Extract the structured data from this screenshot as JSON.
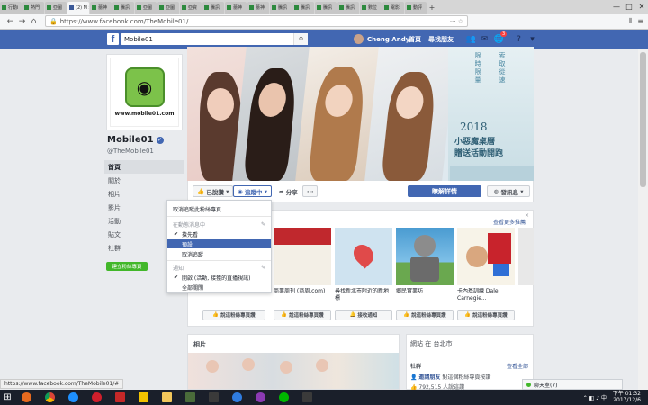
{
  "browser": {
    "tabs": [
      {
        "label": "行動i"
      },
      {
        "label": "熱門"
      },
      {
        "label": "亞圖"
      },
      {
        "label": "(2) M",
        "active": true
      },
      {
        "label": "蕾神"
      },
      {
        "label": "騰訊"
      },
      {
        "label": "亞圖"
      },
      {
        "label": "亞圖"
      },
      {
        "label": "亞資"
      },
      {
        "label": "騰訊"
      },
      {
        "label": "蕾神"
      },
      {
        "label": "蕾神"
      },
      {
        "label": "騰訊"
      },
      {
        "label": "騰訊"
      },
      {
        "label": "騰訊"
      },
      {
        "label": "騰訊"
      },
      {
        "label": "數位"
      },
      {
        "label": "電影"
      },
      {
        "label": "動評"
      }
    ],
    "url": "https://www.facebook.com/TheMobile01/",
    "status_url": "https://www.facebook.com/TheMobile01/#"
  },
  "fb_header": {
    "search_value": "Mobile01",
    "user_name": "Cheng Andy",
    "home": "首頁",
    "find_friends": "尋找朋友",
    "notif_count": "3"
  },
  "profile": {
    "logo_url_text": "www.mobile01.com",
    "name": "Mobile01",
    "handle": "@TheMobile01",
    "nav": [
      "首頁",
      "關於",
      "相片",
      "影片",
      "活動",
      "貼文",
      "社群"
    ],
    "create_page": "建立粉絲專頁"
  },
  "cover": {
    "year": "2018",
    "line1": "小惡魔桌曆",
    "line2": "贈送活動開跑",
    "vert1": "限時限量",
    "vert2": "索取從速"
  },
  "actions": {
    "liked": "已說讚",
    "following": "追蹤中",
    "share": "分享",
    "more": "···",
    "learn_more": "瞭解詳情",
    "message": "發訊息"
  },
  "dropdown": {
    "unfollow": "取消追蹤此粉絲專頁",
    "in_feed": "在動態消息中",
    "see_first": "搶先看",
    "default": "預設",
    "unfollow2": "取消追蹤",
    "notifications": "通知",
    "notif_option": "開啟 (活動, 接獲的直播視訊)",
    "all_off": "全部關閉"
  },
  "suggestions": {
    "see_more": "查看更多推薦",
    "close": "×",
    "cards": [
      {
        "name": "商業周刊 (商周.com)",
        "button": "說這粉絲專頁讚"
      },
      {
        "name": "尋找新北市附近的新地標",
        "button": "接收通知"
      },
      {
        "name": "鄉民實業坊",
        "button": "說這粉絲專頁讚"
      },
      {
        "name": "卡內基訓練 Dale Carnegie...",
        "button": "說這粉絲專頁讚"
      }
    ],
    "first_button": "說這粉絲專頁讚"
  },
  "photos": {
    "title": "相片"
  },
  "website": {
    "title": "網站 在 台北市",
    "community": "社群",
    "see_all": "查看全部",
    "row1": "邀請朋友",
    "row1_suffix": "對這個粉絲專頁按讚",
    "row2": "792,515 人說這讚"
  },
  "chat": {
    "label": "聊天室(7)"
  },
  "taskbar": {
    "time": "下午 01:32",
    "date": "2017/12/6",
    "ime": "中"
  }
}
